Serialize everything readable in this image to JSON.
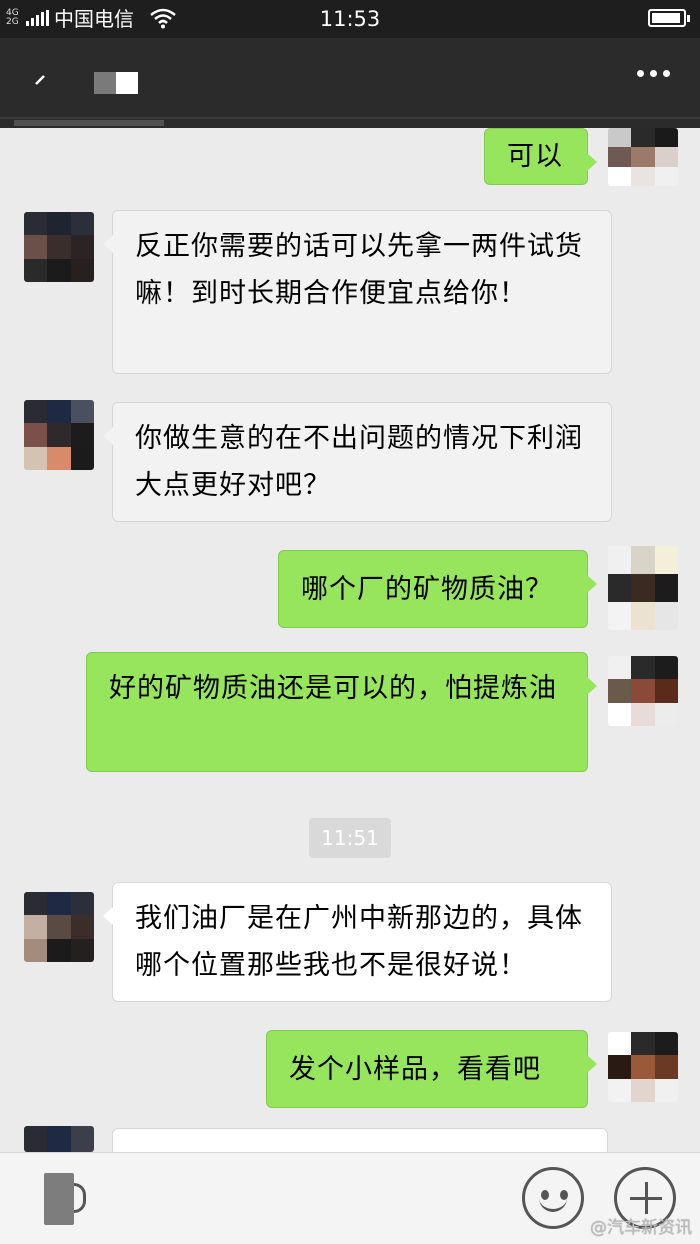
{
  "status_bar": {
    "network": "4G 2G",
    "carrier": "中国电信",
    "time": "11:53"
  },
  "title_bar": {
    "back_icon": "back-arrow-icon",
    "more_icon": "more-dots-icon"
  },
  "messages": [
    {
      "side": "out",
      "text": "可以"
    },
    {
      "side": "in",
      "text": "反正你需要的话可以先拿一两件试货嘛！到时长期合作便宜点给你！"
    },
    {
      "side": "in",
      "text": "你做生意的在不出问题的情况下利润大点更好对吧？"
    },
    {
      "side": "out",
      "text": "哪个厂的矿物质油？"
    },
    {
      "side": "out",
      "text": "好的矿物质油还是可以的，怕提炼油"
    },
    {
      "side": "time",
      "text": "11:51"
    },
    {
      "side": "in",
      "text": "我们油厂是在广州中新那边的，具体哪个位置那些我也不是很好说！"
    },
    {
      "side": "out",
      "text": "发个小样品，看看吧"
    }
  ],
  "input_bar": {
    "voice_icon": "voice-icon",
    "emoji_icon": "emoji-icon",
    "plus_icon": "plus-icon"
  },
  "watermark": "@汽车新资讯",
  "colors": {
    "outgoing_bubble": "#97e55d",
    "incoming_bubble": "#f2f2f2",
    "chat_background": "#ebebeb",
    "header": "#2b2b2b"
  }
}
